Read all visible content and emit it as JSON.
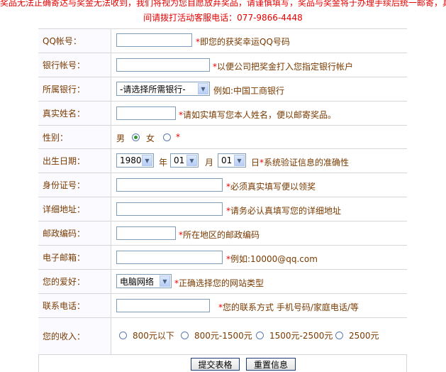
{
  "notice": {
    "line1": "奖品无法正确寄达与奖金无法收到，我们将视为您自愿放弃奖品，请谨慎填写，奖品与奖金将于办理手续后统一邮寄，具体",
    "line2": "间请拨打活动客服电话：077-9866-4448"
  },
  "form": {
    "qq": {
      "label": "QQ帐号：",
      "hint": "即您的获奖幸运QQ号码",
      "value": ""
    },
    "bank_account": {
      "label": "银行帐号：",
      "hint": "以便公司把奖金打入您指定银行帐户",
      "value": ""
    },
    "bank": {
      "label": "所属银行：",
      "selected": "-请选择所需银行-",
      "example": "例如:中国工商银行"
    },
    "real_name": {
      "label": "真实姓名：",
      "hint": "请如实填写您本人姓名，便以邮寄奖品。",
      "value": ""
    },
    "gender": {
      "label": "性别：",
      "male": "男",
      "female": "女",
      "star": "*",
      "selected": "male"
    },
    "birth": {
      "label": "出生日期：",
      "year": "1980",
      "year_unit": "年",
      "month": "01",
      "month_unit": "月",
      "day": "01",
      "day_unit": "日",
      "hint": "系统验证信息的准确性"
    },
    "id_card": {
      "label": "身份证号：",
      "hint": "必须真实填写便以领奖",
      "value": ""
    },
    "address": {
      "label": "详细地址：",
      "hint": "请务必认真填写您的详细地址",
      "value": ""
    },
    "postcode": {
      "label": "邮政编码：",
      "hint": "所在地区的邮政编码",
      "value": ""
    },
    "email": {
      "label": "电子邮箱：",
      "hint": "例如:10000@qq.com",
      "value": ""
    },
    "hobby": {
      "label": "您的爱好：",
      "selected": "电脑网络",
      "hint": "正确选择您的网站类型"
    },
    "phone": {
      "label": "联系电话：",
      "hint": "您的联系方式 手机号码/家庭电话/等",
      "value": ""
    },
    "income": {
      "label": "您的收入：",
      "options": [
        "800元以下",
        "800元-1500元",
        "1500元-2500元",
        "2500元"
      ]
    }
  },
  "buttons": {
    "submit": "提交表格",
    "reset": "重置信息"
  },
  "colors": {
    "notice": "#e60000",
    "label": "#7a3a00",
    "border": "#d7d7d7",
    "radio_checked": "#2f9a2f"
  }
}
